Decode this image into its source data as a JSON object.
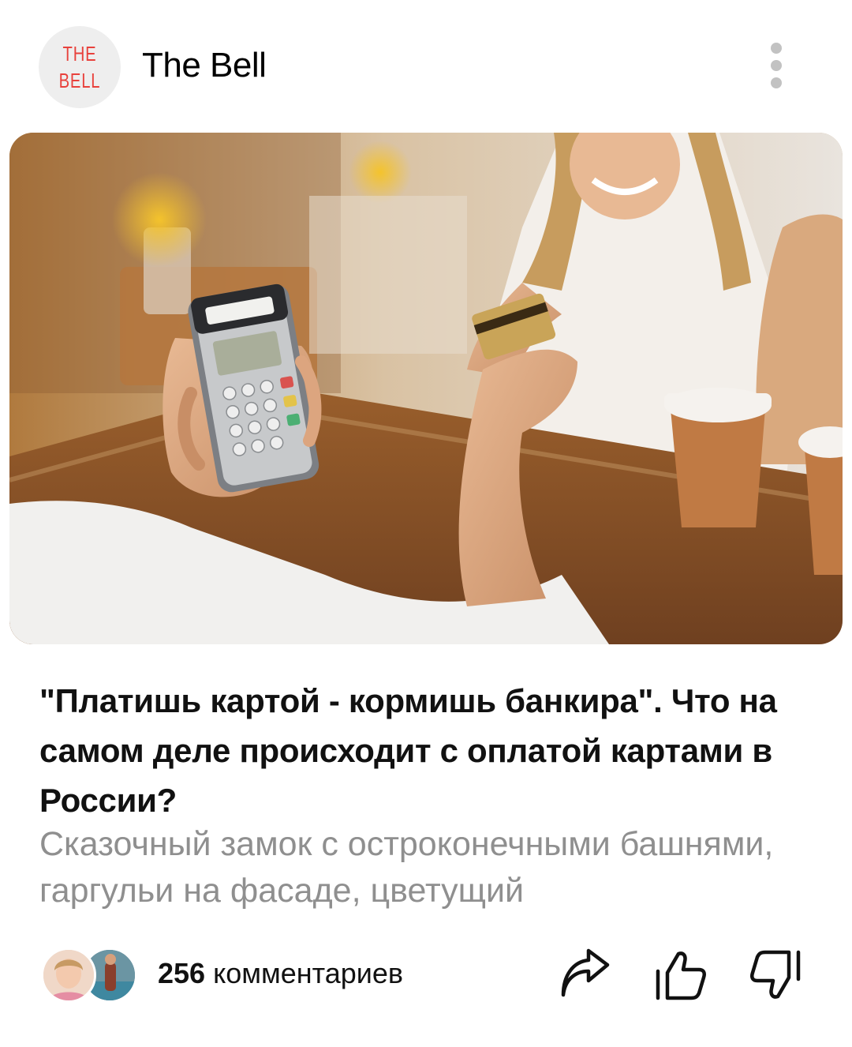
{
  "header": {
    "logo": {
      "line1": "THE",
      "line2": "BELL",
      "accent": "#e8413c",
      "background": "#eeeeee"
    },
    "channel_name": "The Bell",
    "menu_icon": "vertical-dots-icon"
  },
  "post": {
    "image": "payment-terminal-photo",
    "title": "\"Платишь картой - кормишь банкира\". Что на самом деле происходит с оплатой картами в России?",
    "snippet": "Сказочный замок с остроконечными башнями, гаргульи на фасаде, цветущий"
  },
  "footer": {
    "comments_count": "256",
    "comments_label": "комментариев",
    "actions": [
      {
        "icon": "share-icon"
      },
      {
        "icon": "thumbs-up-icon"
      },
      {
        "icon": "thumbs-down-icon"
      }
    ]
  }
}
